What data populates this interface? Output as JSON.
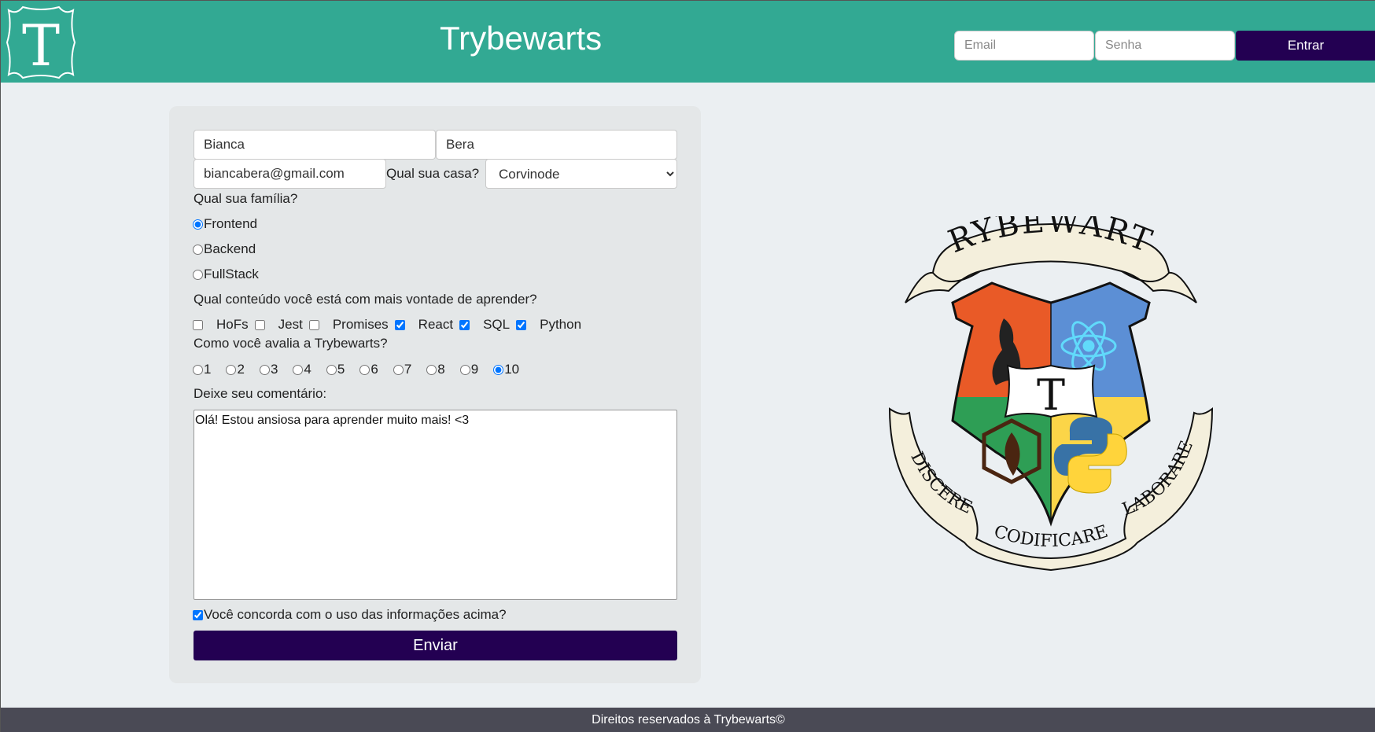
{
  "header": {
    "logo_letter": "T",
    "title": "Trybewarts",
    "login": {
      "email_placeholder": "Email",
      "password_placeholder": "Senha",
      "button_label": "Entrar"
    }
  },
  "form": {
    "first_name": "Bianca",
    "last_name": "Bera",
    "email": "biancabera@gmail.com",
    "house_label": "Qual sua casa?",
    "house_selected": "Corvinode",
    "family_label": "Qual sua família?",
    "family_options": [
      "Frontend",
      "Backend",
      "FullStack"
    ],
    "family_selected": "Frontend",
    "content_label": "Qual conteúdo você está com mais vontade de aprender?",
    "content_options": [
      {
        "label": "HoFs",
        "checked": false
      },
      {
        "label": "Jest",
        "checked": false
      },
      {
        "label": "Promises",
        "checked": false
      },
      {
        "label": "React",
        "checked": true
      },
      {
        "label": "SQL",
        "checked": true
      },
      {
        "label": "Python",
        "checked": true
      }
    ],
    "rating_label": "Como você avalia a Trybewarts?",
    "rating_options": [
      "1",
      "2",
      "3",
      "4",
      "5",
      "6",
      "7",
      "8",
      "9",
      "10"
    ],
    "rating_selected": "10",
    "comment_label": "Deixe seu comentário:",
    "comment_value": "Olá! Estou ansiosa para aprender muito mais! <3",
    "agreement_label": "Você concorda com o uso das informações acima?",
    "agreement_checked": true,
    "submit_label": "Enviar"
  },
  "crest": {
    "banner_top": "TRYBEWARTS",
    "banner_left": "DISCERE",
    "banner_bottom": "CODIFICARE",
    "banner_right": "LABORARE",
    "center_letter": "T",
    "colors": {
      "orange": "#e95a27",
      "blue": "#5c8fd5",
      "green": "#2e9e55",
      "yellow": "#fbd548",
      "banner": "#f4efdc"
    }
  },
  "footer": {
    "text": "Direitos reservados à Trybewarts©"
  },
  "colors": {
    "header_bg": "#32a993",
    "button_bg": "#230052",
    "page_bg": "#ebeff2",
    "panel_bg": "#e4e7e8",
    "footer_bg": "#4a4a55"
  }
}
